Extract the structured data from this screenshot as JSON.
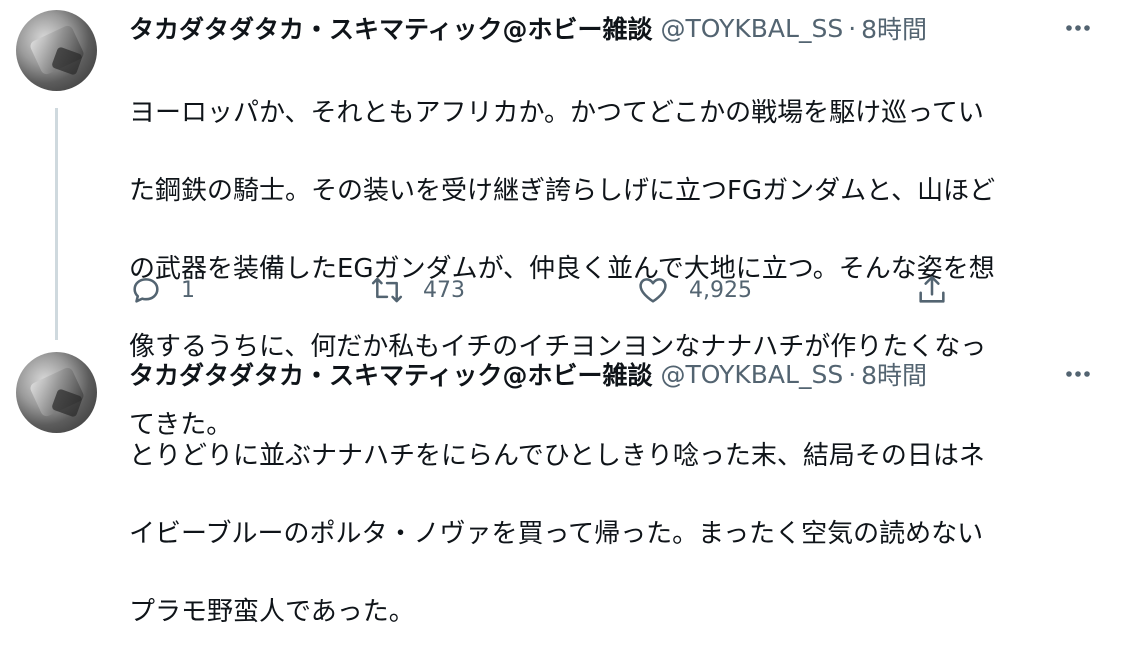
{
  "tweets": [
    {
      "author": {
        "display_name": "タカダタダタカ・スキマティック@ホビー雑談",
        "handle": "@TOYKBAL_SS",
        "separator": "·",
        "timestamp": "8時間"
      },
      "text": "ヨーロッパか、それともアフリカか。かつてどこかの戦場を駆け巡っていた鋼鉄の騎士。その装いを受け継ぎ誇らしげに立つFGガンダムと、山ほどの武器を装備したEGガンダムが、仲良く並んで大地に立つ。そんな姿を想像するうちに、何だか私もイチのイチヨンヨンなナナハチが作りたくなってきた。",
      "text_lines": [
        "ヨーロッパか、それともアフリカか。かつてどこかの戦場を駆け巡ってい",
        "た鋼鉄の騎士。その装いを受け継ぎ誇らしげに立つFGガンダムと、山ほど",
        "の武器を装備したEGガンダムが、仲良く並んで大地に立つ。そんな姿を想",
        "像するうちに、何だか私もイチのイチヨンヨンなナナハチが作りたくなっ",
        "てきた。"
      ],
      "actions": {
        "reply": {
          "icon": "reply-icon",
          "count": "1"
        },
        "retweet": {
          "icon": "retweet-icon",
          "count": "473"
        },
        "like": {
          "icon": "heart-icon",
          "count": "4,925"
        },
        "share": {
          "icon": "share-icon"
        }
      },
      "more_icon": "more-options-icon"
    },
    {
      "author": {
        "display_name": "タカダタダタカ・スキマティック@ホビー雑談",
        "handle": "@TOYKBAL_SS",
        "separator": "·",
        "timestamp": "8時間"
      },
      "text_lines": [
        "とりどりに並ぶナナハチをにらんでひとしきり唸った末、結局その日はネ",
        "イビーブルーのポルタ・ノヴァを買って帰った。まったく空気の読めない",
        "プラモ野蛮人であった。"
      ],
      "more_icon": "more-options-icon"
    }
  ],
  "colors": {
    "text": "#0f1419",
    "secondary": "#536471",
    "thread_line": "#cfd9de",
    "background": "#ffffff"
  }
}
